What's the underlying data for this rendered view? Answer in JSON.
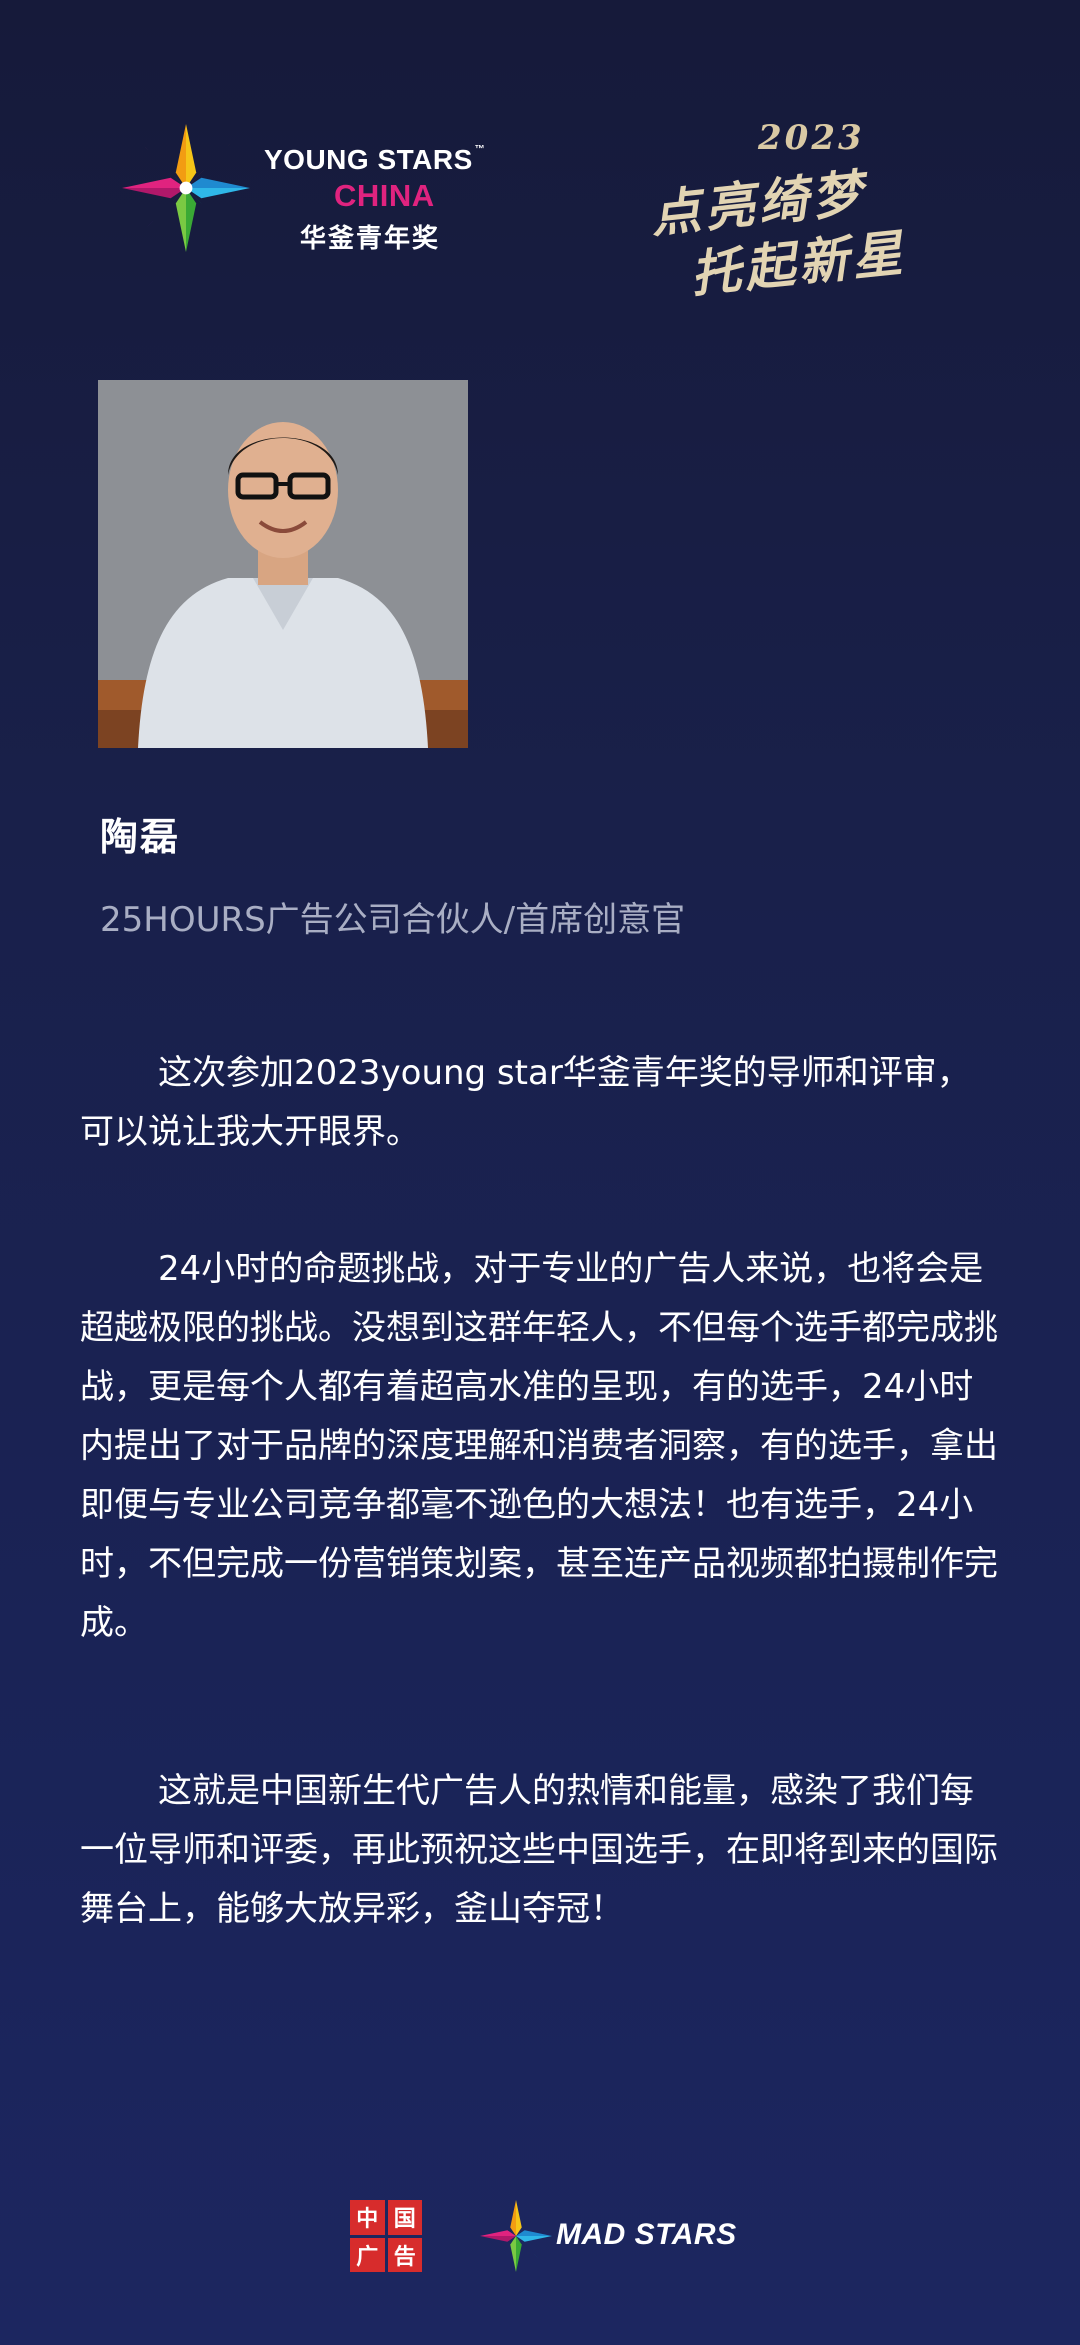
{
  "header": {
    "young_stars_line1": "YOUNG STARS",
    "young_stars_tm": "™",
    "young_stars_line2": "CHINA",
    "young_stars_cn": "华釜青年奖",
    "slogan_year": "2023",
    "slogan_line1": "点亮绮梦",
    "slogan_line2": "托起新星"
  },
  "profile": {
    "name": "陶磊",
    "title": "25HOURS广告公司合伙人/首席创意官"
  },
  "paragraphs": {
    "p1": "这次参加2023young star华釜青年奖的导师和评审，可以说让我大开眼界。",
    "p2": "24小时的命题挑战，对于专业的广告人来说，也将会是超越极限的挑战。没想到这群年轻人，不但每个选手都完成挑战，更是每个人都有着超高水准的呈现，有的选手，24小时内提出了对于品牌的深度理解和消费者洞察，有的选手，拿出即便与专业公司竞争都毫不逊色的大想法！也有选手，24小时，不但完成一份营销策划案，甚至连产品视频都拍摄制作完成。",
    "p3": "这就是中国新生代广告人的热情和能量，感染了我们每一位导师和评委，再此预祝这些中国选手，在即将到来的国际舞台上，能够大放异彩，釜山夺冠！"
  },
  "footer": {
    "cad_chars": [
      "中",
      "国",
      "广",
      "告"
    ],
    "mad_stars": "MAD STARS"
  },
  "colors": {
    "background_top": "#161a3a",
    "background_bottom": "#1c2660",
    "accent_pink": "#e0237f",
    "slogan_gold": "#e2d4b3",
    "subtitle_gray": "#a9aec4",
    "cad_red": "#d72c2c"
  },
  "icons": {
    "young_stars": "multicolor-star-icon",
    "mad_stars": "multicolor-star-icon"
  }
}
